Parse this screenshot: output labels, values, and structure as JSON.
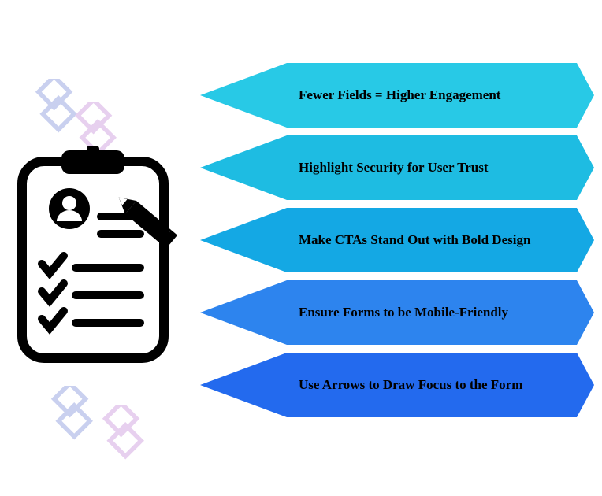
{
  "items": [
    "Fewer Fields = Higher Engagement",
    "Highlight Security for User Trust",
    "Make CTAs Stand Out with Bold Design",
    "Ensure Forms to be Mobile-Friendly",
    "Use Arrows to Draw Focus to the Form"
  ],
  "colors": [
    "#28c9e6",
    "#1ebce2",
    "#14a8e4",
    "#2d84ee",
    "#236aee"
  ]
}
